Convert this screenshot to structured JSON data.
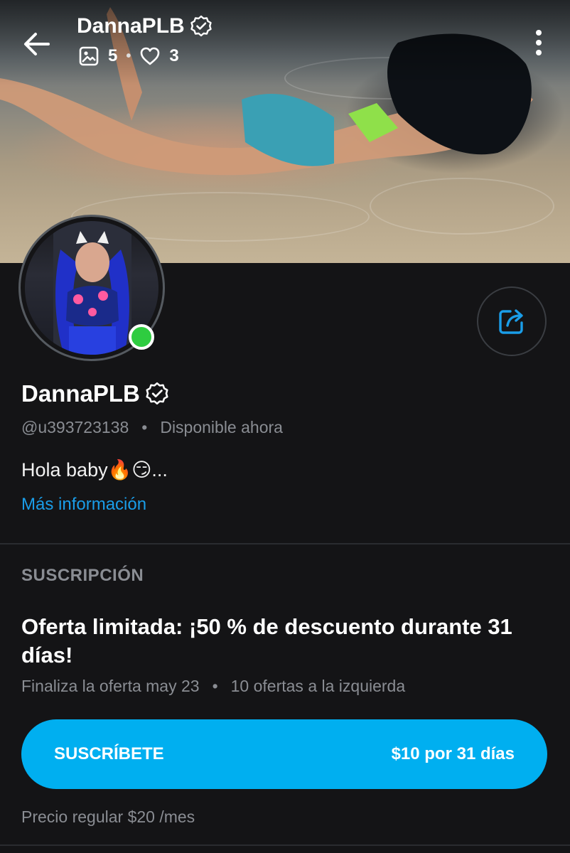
{
  "header": {
    "name": "DannaPLB",
    "photos_count": "5",
    "likes_count": "3",
    "dot": "•"
  },
  "profile": {
    "name": "DannaPLB",
    "handle": "@u393723138",
    "separator": "•",
    "status": "Disponible ahora",
    "bio": "Hola baby🔥😏...",
    "more_info_label": "Más información"
  },
  "subscription": {
    "section_title": "SUSCRIPCIÓN",
    "offer_title": "Oferta limitada: ¡50 % de descuento durante 31 días!",
    "offer_end": "Finaliza la oferta may 23",
    "separator": "•",
    "offers_left": "10 ofertas a la izquierda",
    "button_label": "SUSCRÍBETE",
    "button_price": "$10 por 31 días",
    "regular_price": "Precio regular $20 /mes"
  },
  "colors": {
    "background": "#141416",
    "accent": "#00aff0",
    "link": "#1a9de8",
    "online": "#2ecc40",
    "muted_text": "#8a8d93"
  },
  "icons": {
    "back": "arrow-left-icon",
    "verified": "verified-badge-icon",
    "photos": "image-icon",
    "likes": "heart-icon",
    "menu": "more-vertical-icon",
    "share": "share-icon"
  }
}
